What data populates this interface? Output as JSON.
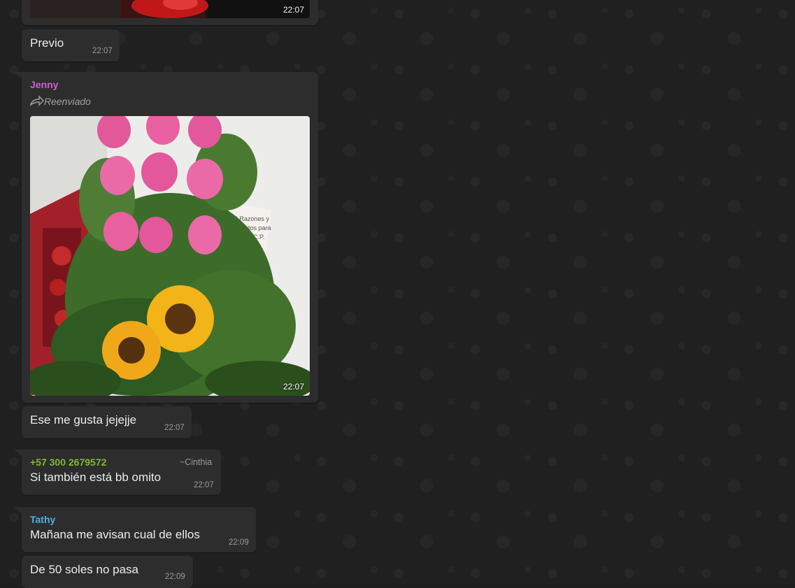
{
  "colors": {
    "bubble_bg": "#2d2d2d",
    "wallpaper_bg": "#202020",
    "sender_jenny": "#d35fd6",
    "sender_phone": "#7fb83a",
    "sender_tathy": "#4fb1e6"
  },
  "messages": [
    {
      "type": "image",
      "time": "22:07",
      "icon": "photo-thumbnail-partial"
    },
    {
      "type": "text",
      "text": "Previo",
      "time": "22:07"
    },
    {
      "type": "image",
      "sender": "Jenny",
      "forwarded_label": "Reenviado",
      "forward_icon": "forward-arrow-icon",
      "photo_icon": "flower-bouquet-photo",
      "time": "22:07"
    },
    {
      "type": "text",
      "text": "Ese me gusta jejejje",
      "time": "22:07"
    },
    {
      "type": "text",
      "sender": "+57 300 2679572",
      "pushname": "~Cinthia",
      "text": "Si también está bb omito",
      "time": "22:07"
    },
    {
      "type": "text",
      "sender": "Tathy",
      "text": "Mañana me avisan cual de ellos",
      "time": "22:09"
    },
    {
      "type": "text",
      "text": "De 50 soles no pasa",
      "time": "22:09"
    }
  ]
}
